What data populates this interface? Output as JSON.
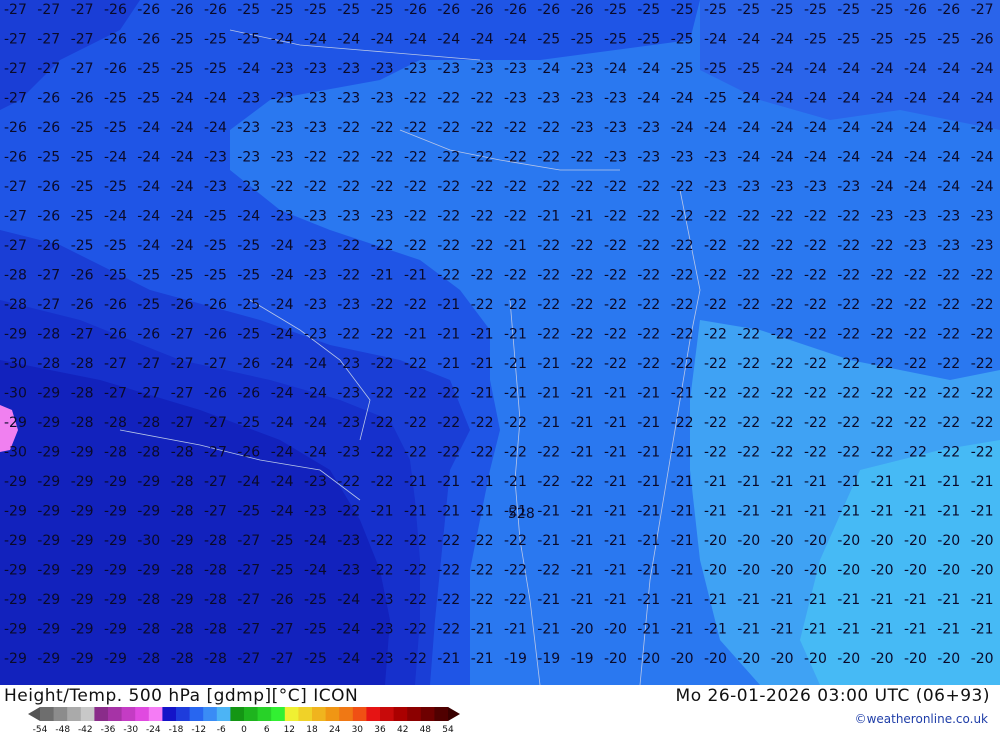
{
  "header": {
    "title_left": "Height/Temp. 500 hPa [gdmp][°C] ICON",
    "title_right": "Mo 26-01-2026 03:00 UTC (06+93)",
    "credit": "©weatheronline.co.uk"
  },
  "map": {
    "low_label": "528",
    "contours": [
      {
        "row": 0,
        "labels": [
          "-27",
          "-27",
          "-27",
          "-26",
          "-26",
          "-26",
          "-26",
          "-25",
          "-25",
          "-25",
          "-25",
          "-25",
          "-26",
          "-26",
          "-26",
          "-26",
          "-26",
          "-26",
          "-25",
          "-25",
          "-25",
          "-25",
          "-25",
          "-25",
          "-25",
          "-25",
          "-25",
          "-26",
          "-26",
          "-27"
        ]
      },
      {
        "row": 1,
        "labels": [
          "-27",
          "-27",
          "-27",
          "-26",
          "-26",
          "-25",
          "-25",
          "-25",
          "-24",
          "-24",
          "-24",
          "-24",
          "-24",
          "-24",
          "-24",
          "-24",
          "-25",
          "-25",
          "-25",
          "-25",
          "-25",
          "-24",
          "-24",
          "-24",
          "-25",
          "-25",
          "-25",
          "-25",
          "-25",
          "-26"
        ]
      },
      {
        "row": 2,
        "labels": [
          "-27",
          "-27",
          "-27",
          "-26",
          "-25",
          "-25",
          "-25",
          "-24",
          "-23",
          "-23",
          "-23",
          "-23",
          "-23",
          "-23",
          "-23",
          "-23",
          "-24",
          "-23",
          "-24",
          "-24",
          "-25",
          "-25",
          "-25",
          "-24",
          "-24",
          "-24",
          "-24",
          "-24",
          "-24",
          "-24"
        ]
      },
      {
        "row": 3,
        "labels": [
          "-27",
          "-26",
          "-26",
          "-25",
          "-25",
          "-24",
          "-24",
          "-23",
          "-23",
          "-23",
          "-23",
          "-23",
          "-22",
          "-22",
          "-22",
          "-23",
          "-23",
          "-23",
          "-23",
          "-24",
          "-24",
          "-25",
          "-24",
          "-24",
          "-24",
          "-24",
          "-24",
          "-24",
          "-24",
          "-24"
        ]
      },
      {
        "row": 4,
        "labels": [
          "-26",
          "-26",
          "-25",
          "-25",
          "-24",
          "-24",
          "-24",
          "-23",
          "-23",
          "-23",
          "-22",
          "-22",
          "-22",
          "-22",
          "-22",
          "-22",
          "-22",
          "-23",
          "-23",
          "-23",
          "-24",
          "-24",
          "-24",
          "-24",
          "-24",
          "-24",
          "-24",
          "-24",
          "-24",
          "-24"
        ]
      },
      {
        "row": 5,
        "labels": [
          "-26",
          "-25",
          "-25",
          "-24",
          "-24",
          "-24",
          "-23",
          "-23",
          "-23",
          "-22",
          "-22",
          "-22",
          "-22",
          "-22",
          "-22",
          "-22",
          "-22",
          "-22",
          "-23",
          "-23",
          "-23",
          "-23",
          "-24",
          "-24",
          "-24",
          "-24",
          "-24",
          "-24",
          "-24",
          "-24"
        ]
      },
      {
        "row": 6,
        "labels": [
          "-27",
          "-26",
          "-25",
          "-25",
          "-24",
          "-24",
          "-23",
          "-23",
          "-22",
          "-22",
          "-22",
          "-22",
          "-22",
          "-22",
          "-22",
          "-22",
          "-22",
          "-22",
          "-22",
          "-22",
          "-22",
          "-23",
          "-23",
          "-23",
          "-23",
          "-23",
          "-24",
          "-24",
          "-24",
          "-24"
        ]
      },
      {
        "row": 7,
        "labels": [
          "-27",
          "-26",
          "-25",
          "-24",
          "-24",
          "-24",
          "-25",
          "-24",
          "-23",
          "-23",
          "-23",
          "-23",
          "-22",
          "-22",
          "-22",
          "-22",
          "-21",
          "-21",
          "-22",
          "-22",
          "-22",
          "-22",
          "-22",
          "-22",
          "-22",
          "-22",
          "-23",
          "-23",
          "-23",
          "-23"
        ]
      },
      {
        "row": 8,
        "labels": [
          "-27",
          "-26",
          "-25",
          "-25",
          "-24",
          "-24",
          "-25",
          "-25",
          "-24",
          "-23",
          "-22",
          "-22",
          "-22",
          "-22",
          "-22",
          "-21",
          "-22",
          "-22",
          "-22",
          "-22",
          "-22",
          "-22",
          "-22",
          "-22",
          "-22",
          "-22",
          "-22",
          "-23",
          "-23",
          "-23"
        ]
      },
      {
        "row": 9,
        "labels": [
          "-28",
          "-27",
          "-26",
          "-25",
          "-25",
          "-25",
          "-25",
          "-25",
          "-24",
          "-23",
          "-22",
          "-21",
          "-21",
          "-22",
          "-22",
          "-22",
          "-22",
          "-22",
          "-22",
          "-22",
          "-22",
          "-22",
          "-22",
          "-22",
          "-22",
          "-22",
          "-22",
          "-22",
          "-22",
          "-22"
        ]
      },
      {
        "row": 10,
        "labels": [
          "-28",
          "-27",
          "-26",
          "-26",
          "-25",
          "-26",
          "-26",
          "-25",
          "-24",
          "-23",
          "-23",
          "-22",
          "-22",
          "-21",
          "-22",
          "-22",
          "-22",
          "-22",
          "-22",
          "-22",
          "-22",
          "-22",
          "-22",
          "-22",
          "-22",
          "-22",
          "-22",
          "-22",
          "-22",
          "-22"
        ]
      },
      {
        "row": 11,
        "labels": [
          "-29",
          "-28",
          "-27",
          "-26",
          "-26",
          "-27",
          "-26",
          "-25",
          "-24",
          "-23",
          "-22",
          "-22",
          "-21",
          "-21",
          "-21",
          "-21",
          "-22",
          "-22",
          "-22",
          "-22",
          "-22",
          "-22",
          "-22",
          "-22",
          "-22",
          "-22",
          "-22",
          "-22",
          "-22",
          "-22"
        ]
      },
      {
        "row": 12,
        "labels": [
          "-30",
          "-28",
          "-28",
          "-27",
          "-27",
          "-27",
          "-27",
          "-26",
          "-24",
          "-24",
          "-23",
          "-22",
          "-22",
          "-21",
          "-21",
          "-21",
          "-21",
          "-22",
          "-22",
          "-22",
          "-22",
          "-22",
          "-22",
          "-22",
          "-22",
          "-22",
          "-22",
          "-22",
          "-22",
          "-22"
        ]
      },
      {
        "row": 13,
        "labels": [
          "-30",
          "-29",
          "-28",
          "-27",
          "-27",
          "-27",
          "-26",
          "-26",
          "-24",
          "-24",
          "-23",
          "-22",
          "-22",
          "-22",
          "-21",
          "-21",
          "-21",
          "-21",
          "-21",
          "-21",
          "-21",
          "-22",
          "-22",
          "-22",
          "-22",
          "-22",
          "-22",
          "-22",
          "-22",
          "-22"
        ]
      },
      {
        "row": 14,
        "labels": [
          "-29",
          "-29",
          "-28",
          "-28",
          "-28",
          "-27",
          "-27",
          "-25",
          "-24",
          "-24",
          "-23",
          "-22",
          "-22",
          "-22",
          "-22",
          "-22",
          "-21",
          "-21",
          "-21",
          "-21",
          "-22",
          "-22",
          "-22",
          "-22",
          "-22",
          "-22",
          "-22",
          "-22",
          "-22",
          "-22"
        ]
      },
      {
        "row": 15,
        "labels": [
          "-30",
          "-29",
          "-29",
          "-28",
          "-28",
          "-28",
          "-27",
          "-26",
          "-24",
          "-24",
          "-23",
          "-22",
          "-22",
          "-22",
          "-22",
          "-22",
          "-22",
          "-21",
          "-21",
          "-21",
          "-21",
          "-22",
          "-22",
          "-22",
          "-22",
          "-22",
          "-22",
          "-22",
          "-22",
          "-22"
        ]
      },
      {
        "row": 16,
        "labels": [
          "-29",
          "-29",
          "-29",
          "-29",
          "-29",
          "-28",
          "-27",
          "-24",
          "-24",
          "-23",
          "-22",
          "-22",
          "-21",
          "-21",
          "-21",
          "-21",
          "-22",
          "-22",
          "-21",
          "-21",
          "-21",
          "-21",
          "-21",
          "-21",
          "-21",
          "-21",
          "-21",
          "-21",
          "-21",
          "-21"
        ]
      },
      {
        "row": 17,
        "labels": [
          "-29",
          "-29",
          "-29",
          "-29",
          "-29",
          "-28",
          "-27",
          "-25",
          "-24",
          "-23",
          "-22",
          "-21",
          "-21",
          "-21",
          "-21",
          "-21",
          "-21",
          "-21",
          "-21",
          "-21",
          "-21",
          "-21",
          "-21",
          "-21",
          "-21",
          "-21",
          "-21",
          "-21",
          "-21",
          "-21"
        ]
      },
      {
        "row": 18,
        "labels": [
          "-29",
          "-29",
          "-29",
          "-29",
          "-30",
          "-29",
          "-28",
          "-27",
          "-25",
          "-24",
          "-23",
          "-22",
          "-22",
          "-22",
          "-22",
          "-22",
          "-21",
          "-21",
          "-21",
          "-21",
          "-21",
          "-20",
          "-20",
          "-20",
          "-20",
          "-20",
          "-20",
          "-20",
          "-20",
          "-20"
        ]
      },
      {
        "row": 19,
        "labels": [
          "-29",
          "-29",
          "-29",
          "-29",
          "-29",
          "-28",
          "-28",
          "-27",
          "-25",
          "-24",
          "-23",
          "-22",
          "-22",
          "-22",
          "-22",
          "-22",
          "-22",
          "-21",
          "-21",
          "-21",
          "-21",
          "-20",
          "-20",
          "-20",
          "-20",
          "-20",
          "-20",
          "-20",
          "-20",
          "-20"
        ]
      },
      {
        "row": 20,
        "labels": [
          "-29",
          "-29",
          "-29",
          "-29",
          "-28",
          "-29",
          "-28",
          "-27",
          "-26",
          "-25",
          "-24",
          "-23",
          "-22",
          "-22",
          "-22",
          "-22",
          "-21",
          "-21",
          "-21",
          "-21",
          "-21",
          "-21",
          "-21",
          "-21",
          "-21",
          "-21",
          "-21",
          "-21",
          "-21",
          "-21"
        ]
      },
      {
        "row": 21,
        "labels": [
          "-29",
          "-29",
          "-29",
          "-29",
          "-28",
          "-28",
          "-28",
          "-27",
          "-27",
          "-25",
          "-24",
          "-23",
          "-22",
          "-22",
          "-21",
          "-21",
          "-21",
          "-20",
          "-20",
          "-21",
          "-21",
          "-21",
          "-21",
          "-21",
          "-21",
          "-21",
          "-21",
          "-21",
          "-21",
          "-21"
        ]
      },
      {
        "row": 22,
        "labels": [
          "-29",
          "-29",
          "-29",
          "-29",
          "-28",
          "-28",
          "-28",
          "-27",
          "-27",
          "-25",
          "-24",
          "-23",
          "-22",
          "-21",
          "-21",
          "-19",
          "-19",
          "-19",
          "-20",
          "-20",
          "-20",
          "-20",
          "-20",
          "-20",
          "-20",
          "-20",
          "-20",
          "-20",
          "-20",
          "-20"
        ]
      }
    ]
  },
  "legend": {
    "ticks": [
      "-54",
      "-48",
      "-42",
      "-36",
      "-30",
      "-24",
      "-18",
      "-12",
      "-6",
      "0",
      "6",
      "12",
      "18",
      "24",
      "30",
      "36",
      "42",
      "48",
      "54"
    ],
    "colors": [
      "#6e6e6e",
      "#8c8c8c",
      "#aaaaaa",
      "#c8c8c8",
      "#8a2c8a",
      "#a633a6",
      "#c43cc4",
      "#e04ae0",
      "#f57cf5",
      "#1414c8",
      "#1e3cdc",
      "#2866f0",
      "#3a8cf5",
      "#4cb4f5",
      "#149614",
      "#1eb41e",
      "#28d228",
      "#32f032",
      "#f0f032",
      "#f0d228",
      "#f0b41e",
      "#f09614",
      "#f07814",
      "#f05014",
      "#e61414",
      "#c80a0a",
      "#aa0000",
      "#8c0000",
      "#6e0000",
      "#500000"
    ]
  }
}
